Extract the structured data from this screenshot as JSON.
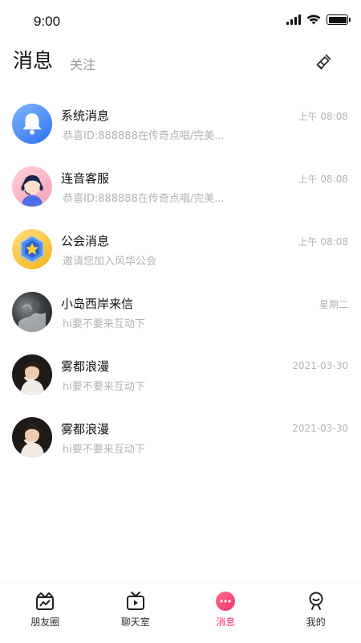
{
  "status": {
    "time": "9:00"
  },
  "header": {
    "title": "消息",
    "follow_tab": "关注"
  },
  "messages": [
    {
      "name": "系统消息",
      "preview": "恭喜ID:888888在传奇点唱/完美...",
      "time": "上午 08:08",
      "avatar": "bell-icon"
    },
    {
      "name": "连音客服",
      "preview": "恭喜ID:888888在传奇点唱/完美...",
      "time": "上午 08:08",
      "avatar": "customer-service-avatar"
    },
    {
      "name": "公会消息",
      "preview": "邀请您加入风华公会",
      "time": "上午 08:08",
      "avatar": "guild-badge-icon"
    },
    {
      "name": "小岛西岸来信",
      "preview": "hi要不要来互动下",
      "time": "星期二",
      "avatar": "user-photo"
    },
    {
      "name": "雾都浪漫",
      "preview": "hi要不要来互动下",
      "time": "2021-03-30",
      "avatar": "user-photo"
    },
    {
      "name": "雾都浪漫",
      "preview": "hi要不要来互动下",
      "time": "2021-03-30",
      "avatar": "user-photo"
    }
  ],
  "tabbar": {
    "items": [
      {
        "label": "朋友圈",
        "icon": "crown-image-icon",
        "active": false
      },
      {
        "label": "聊天室",
        "icon": "tv-icon",
        "active": false
      },
      {
        "label": "消息",
        "icon": "chat-bubble-icon",
        "active": true
      },
      {
        "label": "我的",
        "icon": "user-icon",
        "active": false
      }
    ]
  },
  "colors": {
    "accent": "#f2336e",
    "text_secondary": "#b3b3b3"
  }
}
